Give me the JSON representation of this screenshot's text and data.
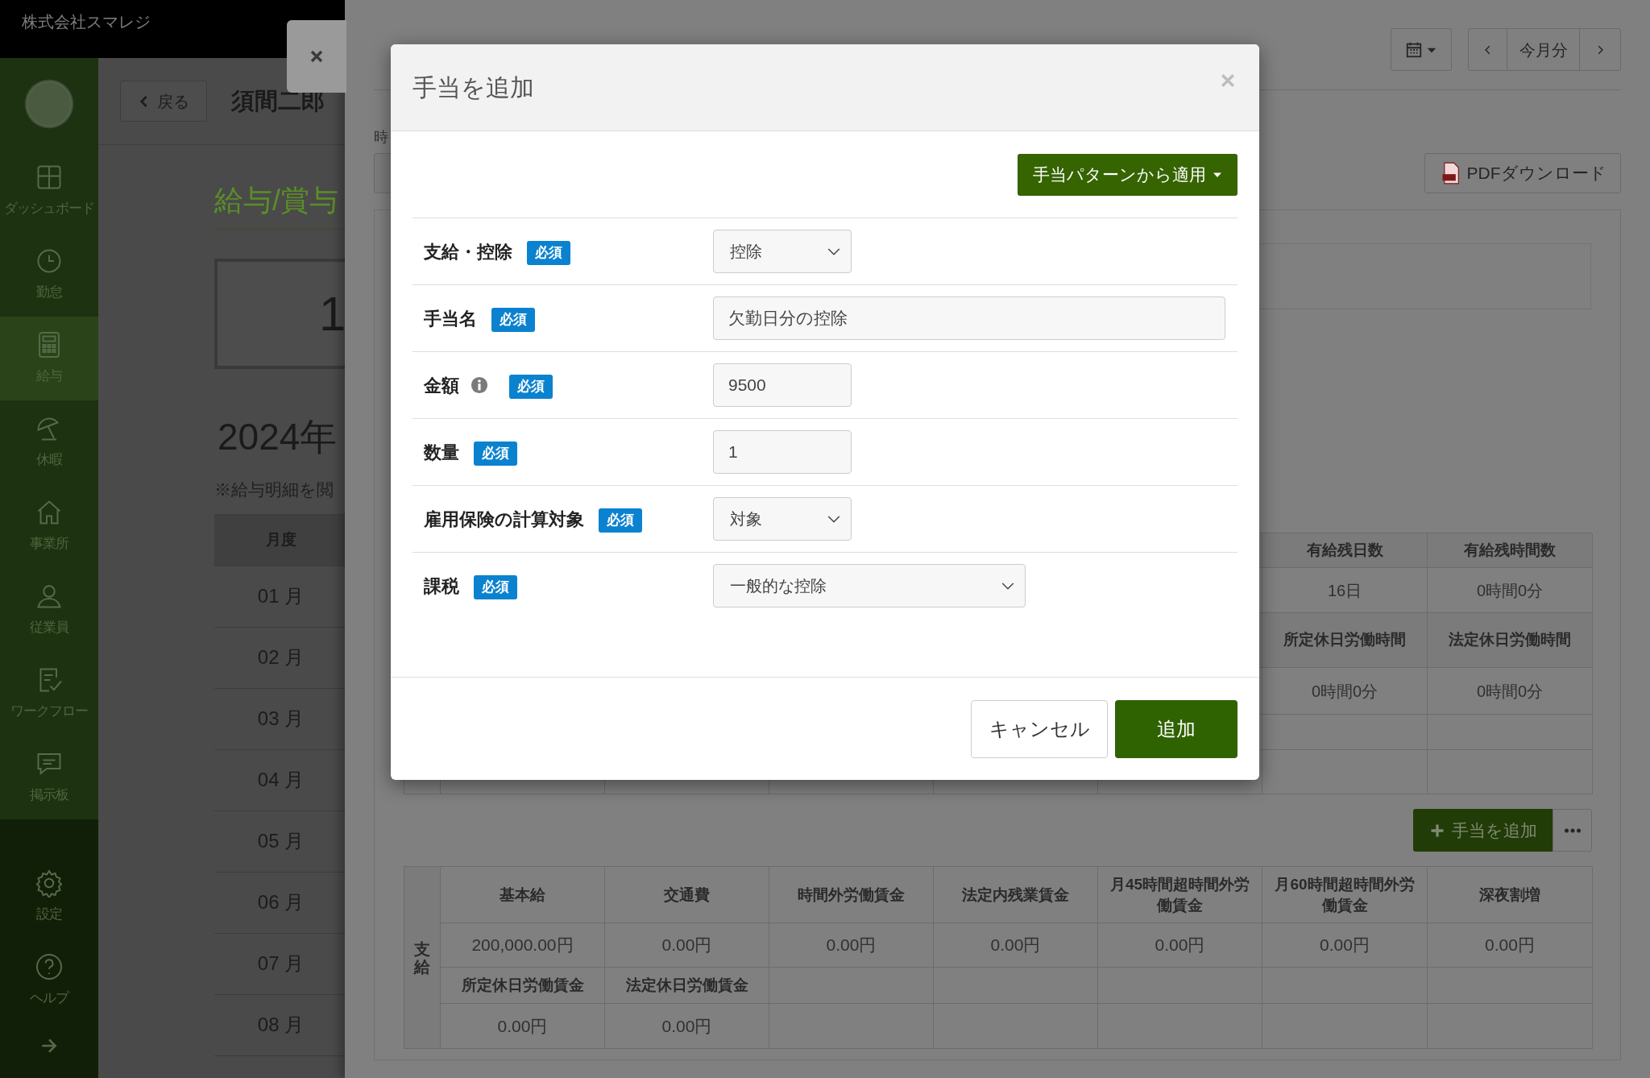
{
  "header": {
    "company": "株式会社スマレジ"
  },
  "sidebar": {
    "items": [
      {
        "label": "ダッシュボード",
        "selected": false
      },
      {
        "label": "勤怠",
        "selected": false
      },
      {
        "label": "給与",
        "selected": true
      },
      {
        "label": "休暇",
        "selected": false
      },
      {
        "label": "事業所",
        "selected": false
      },
      {
        "label": "従業員",
        "selected": false
      },
      {
        "label": "ワークフロー",
        "selected": false
      },
      {
        "label": "掲示板",
        "selected": false
      }
    ],
    "footer_items": [
      {
        "label": "設定",
        "selected": false
      },
      {
        "label": "ヘルプ",
        "selected": false
      }
    ]
  },
  "employee_page": {
    "back_button": "戻る",
    "employee_name": "須間二郎",
    "section_title": "給与/賞与",
    "summary_value": "1",
    "year": "2024年",
    "note": "※給与明細を閲",
    "table": {
      "columns": [
        "月度"
      ],
      "rows": [
        "01 月",
        "02 月",
        "03 月",
        "04 月",
        "05 月",
        "06 月",
        "07 月",
        "08 月"
      ]
    }
  },
  "detail_panel": {
    "period_button": "今月分",
    "field_label": "時",
    "pdf_button": "PDFダウンロード",
    "leave_table": {
      "rows": [
        {
          "kind": "header",
          "cells": [
            "有給残日数",
            "有給残時間数"
          ]
        },
        {
          "kind": "value",
          "cells": [
            "16日",
            "0時間0分"
          ]
        },
        {
          "kind": "header",
          "cells": [
            "所定休日労働時間",
            "法定休日労働時間"
          ]
        },
        {
          "kind": "value",
          "cells": [
            "0時間0分",
            "0時間0分"
          ]
        },
        {
          "kind": "empty"
        },
        {
          "kind": "empty"
        }
      ]
    },
    "add_button": "手当を追加",
    "pay_table": {
      "group_label": "支給",
      "rows": [
        {
          "kind": "header",
          "cells": [
            "基本給",
            "交通費",
            "時間外労働賃金",
            "法定内残業賃金",
            "月45時間超時間外労働賃金",
            "月60時間超時間外労働賃金",
            "深夜割増"
          ]
        },
        {
          "kind": "value",
          "cells": [
            "200,000.00円",
            "0.00円",
            "0.00円",
            "0.00円",
            "0.00円",
            "0.00円",
            "0.00円"
          ]
        },
        {
          "kind": "header",
          "cells": [
            "所定休日労働賃金",
            "法定休日労働賃金"
          ]
        },
        {
          "kind": "value",
          "cells": [
            "0.00円",
            "0.00円"
          ]
        }
      ]
    }
  },
  "modal": {
    "title": "手当を追加",
    "pattern_button": "手当パターンから適用",
    "fields": [
      {
        "label": "支給・控除",
        "info": false,
        "badge": "必須",
        "kind": "select",
        "value": "控除"
      },
      {
        "label": "手当名",
        "info": false,
        "badge": "必須",
        "kind": "text",
        "value": "欠勤日分の控除"
      },
      {
        "label": "金額",
        "info": true,
        "badge": "必須",
        "kind": "text",
        "value": "9500"
      },
      {
        "label": "数量",
        "info": false,
        "badge": "必須",
        "kind": "text",
        "value": "1"
      },
      {
        "label": "雇用保険の計算対象",
        "info": false,
        "badge": "必須",
        "kind": "select",
        "value": "対象"
      },
      {
        "label": "課税",
        "info": false,
        "badge": "必須",
        "kind": "select",
        "value": "一般的な控除"
      }
    ],
    "cancel_button": "キャンセル",
    "submit_button": "追加"
  }
}
